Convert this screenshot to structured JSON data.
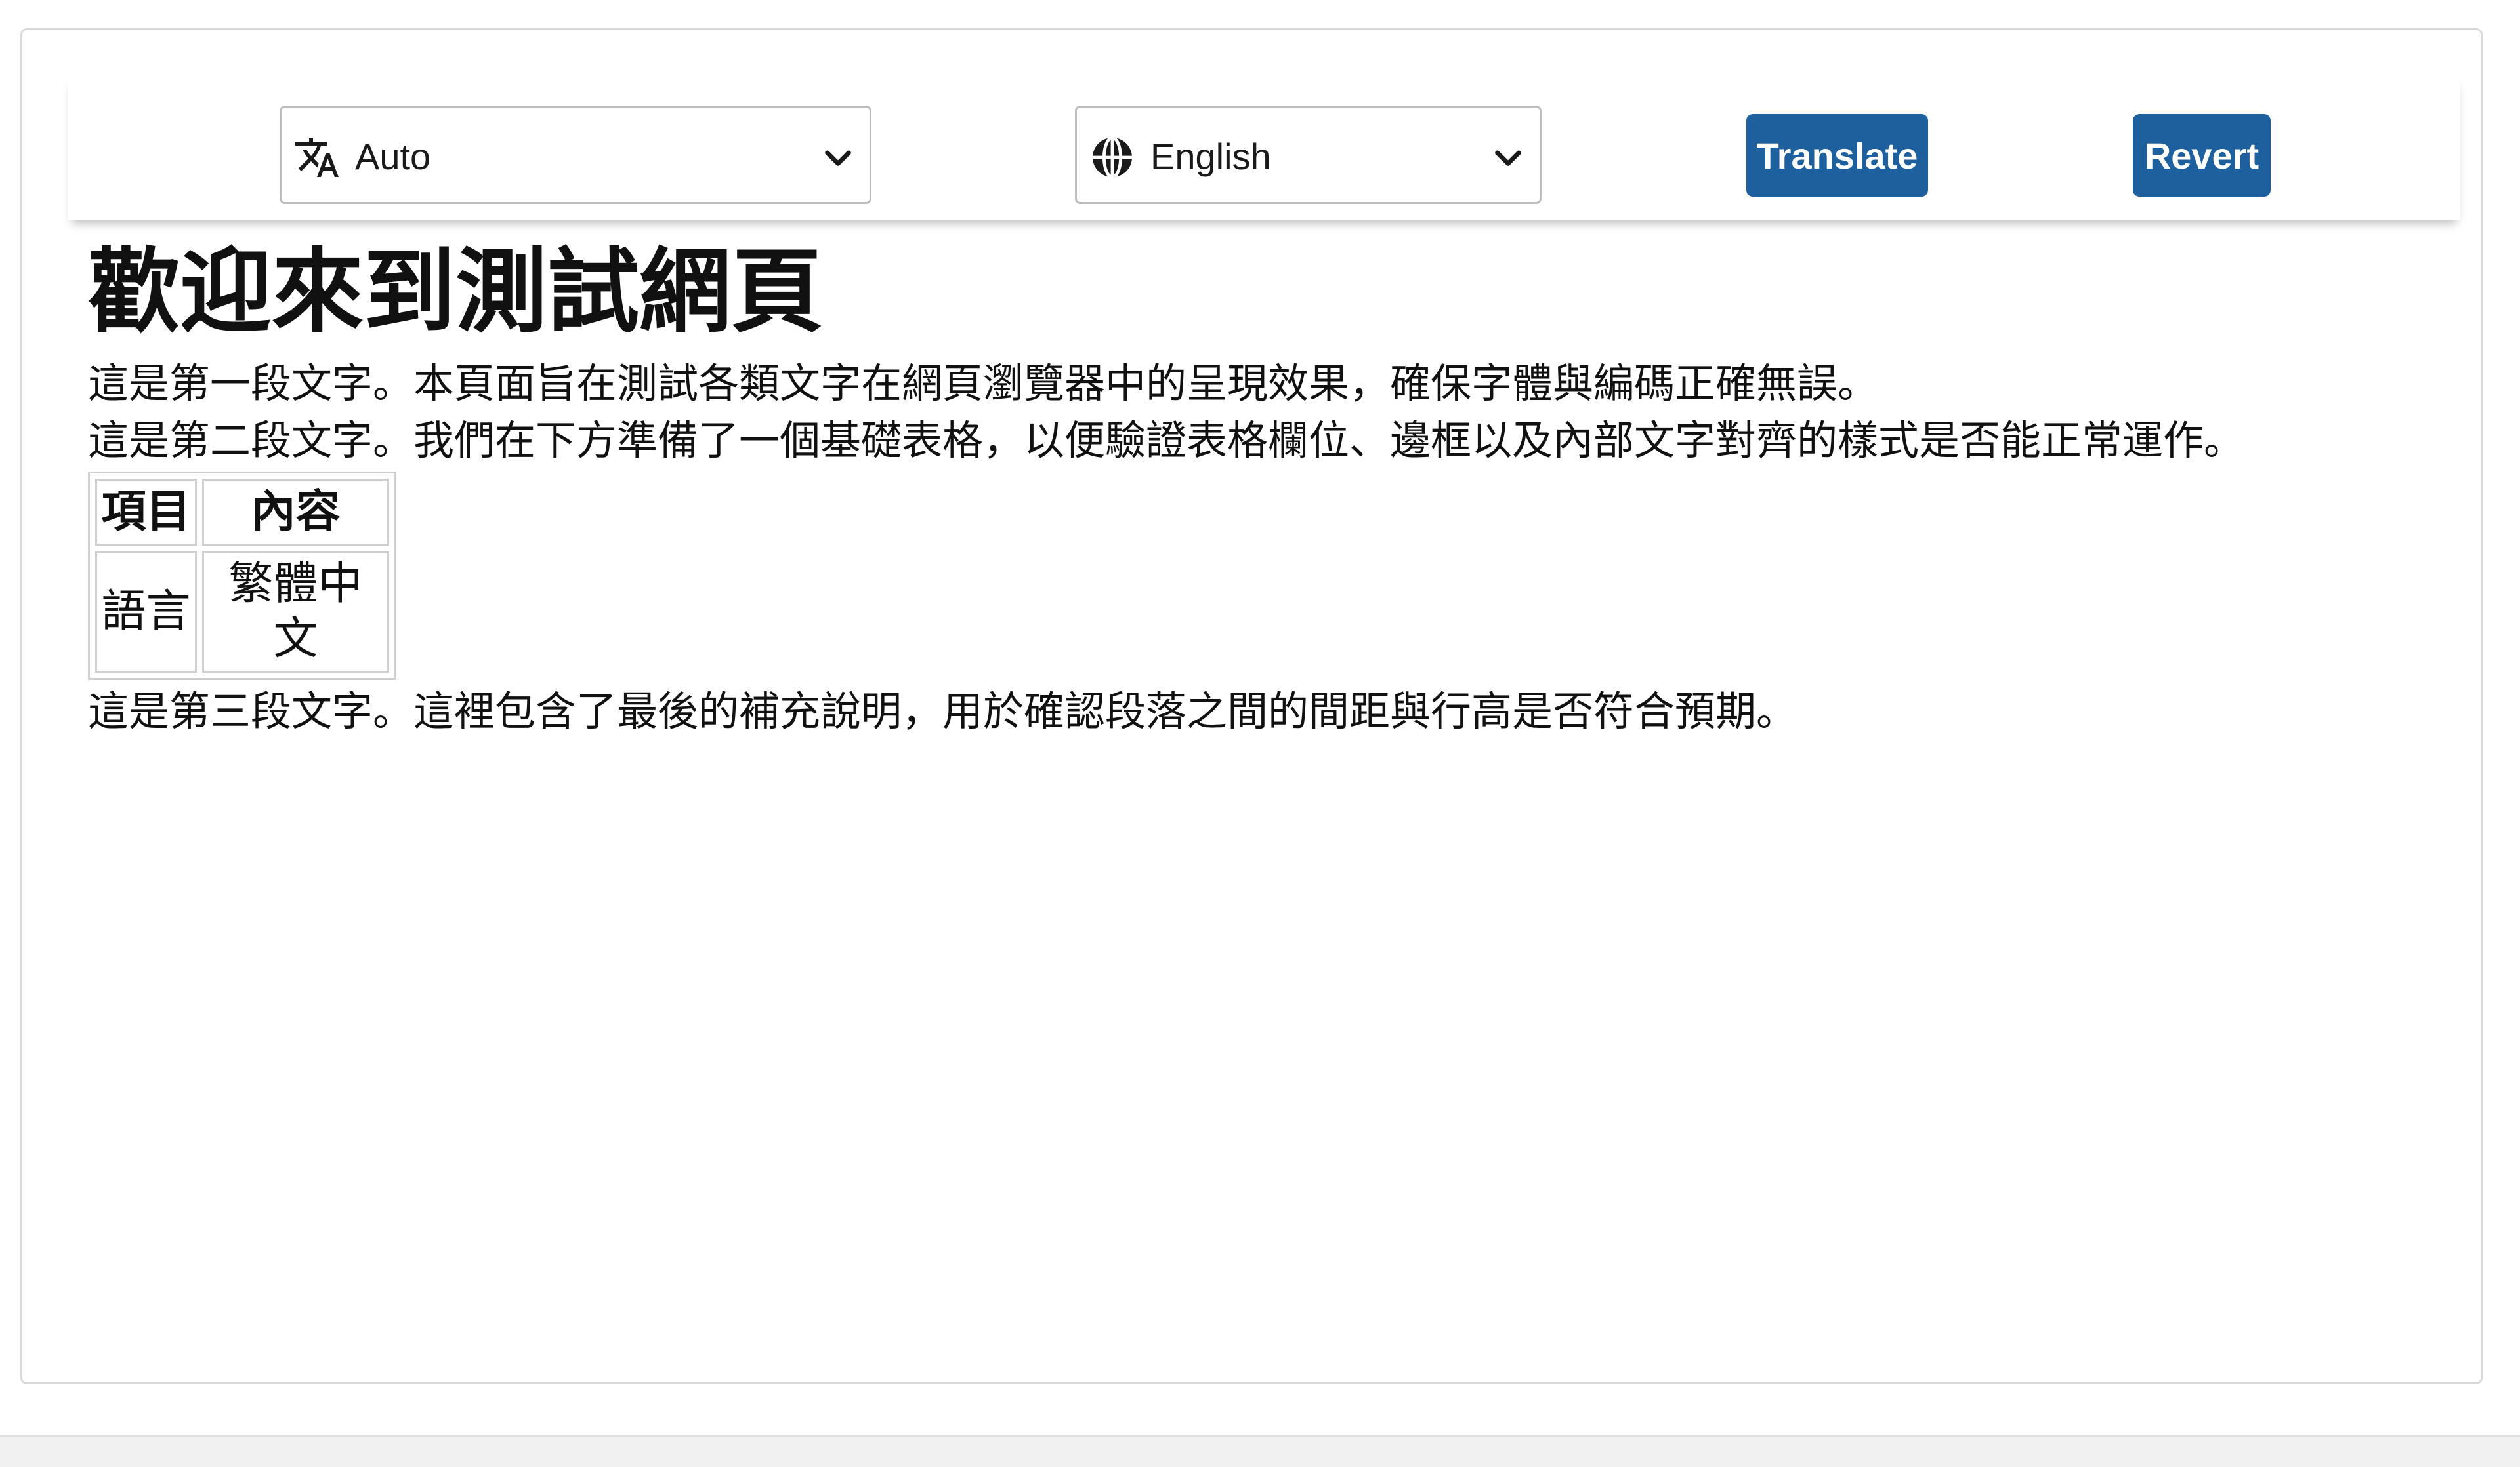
{
  "toolbar": {
    "source_language": "Auto",
    "target_language": "English",
    "translate_label": "Translate",
    "revert_label": "Revert",
    "icons": {
      "source": "translate-icon",
      "target": "globe-icon",
      "dropdown": "chevron-down-icon"
    },
    "accent_color": "#1e5f9e"
  },
  "page": {
    "heading": "歡迎來到測試網頁",
    "paragraphs": [
      "這是第一段文字。本頁面旨在測試各類文字在網頁瀏覽器中的呈現效果，確保字體與編碼正確無誤。",
      "這是第二段文字。我們在下方準備了一個基礎表格，以便驗證表格欄位、邊框以及內部文字對齊的樣式是否能正常運作。",
      "這是第三段文字。這裡包含了最後的補充說明，用於確認段落之間的間距與行高是否符合預期。"
    ],
    "table": {
      "headers": [
        "項目",
        "內容"
      ],
      "rows": [
        [
          "語言",
          "繁體中文"
        ]
      ]
    }
  }
}
